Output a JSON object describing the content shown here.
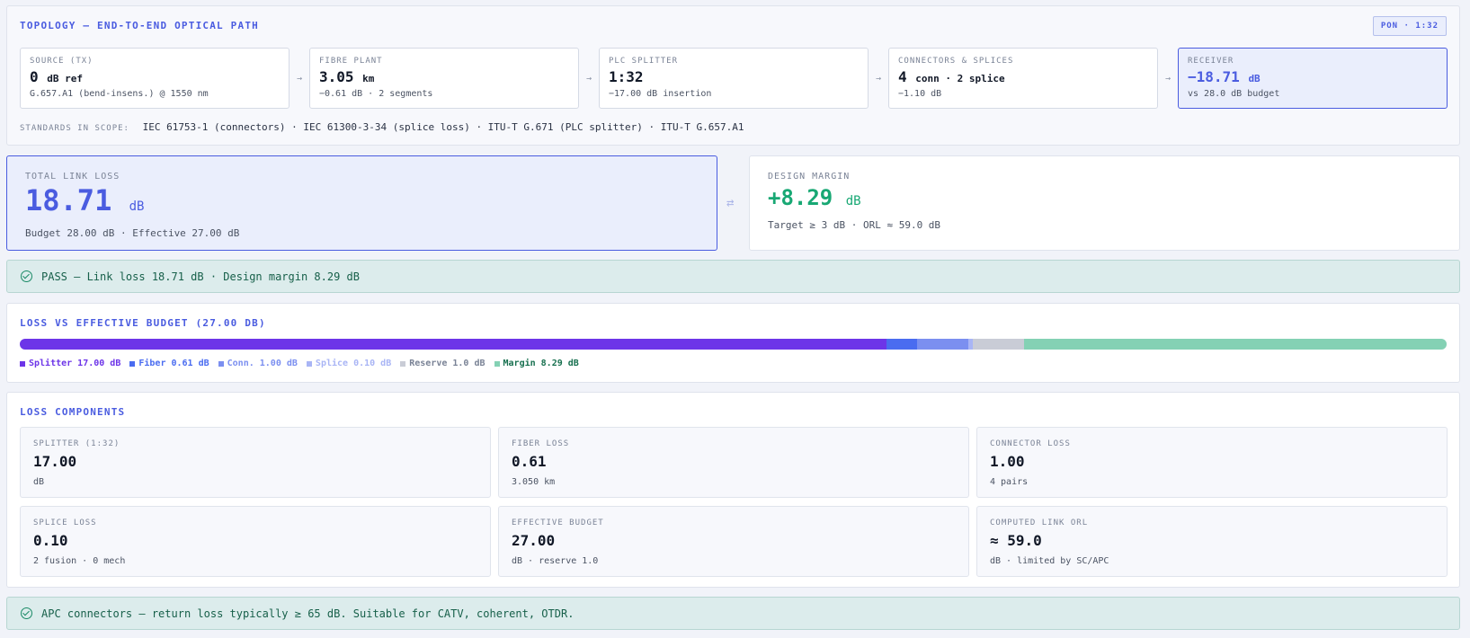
{
  "topology": {
    "title": "TOPOLOGY — END-TO-END OPTICAL PATH",
    "badge": "PON · 1:32",
    "arrow": "→",
    "cards": [
      {
        "label": "SOURCE (TX)",
        "value": "0",
        "unit": "dB ref",
        "sub": "G.657.A1 (bend-insens.) @ 1550 nm"
      },
      {
        "label": "FIBRE PLANT",
        "value": "3.05",
        "unit": "km",
        "sub": "−0.61 dB · 2 segments"
      },
      {
        "label": "PLC SPLITTER",
        "value": "1:32",
        "unit": "",
        "sub": "−17.00 dB insertion"
      },
      {
        "label": "CONNECTORS & SPLICES",
        "value": "4",
        "unit": "conn · 2 splice",
        "sub": "−1.10 dB"
      },
      {
        "label": "RECEIVER",
        "value": "−18.71",
        "unit": "dB",
        "sub": "vs 28.0 dB budget"
      }
    ],
    "standards_label": "STANDARDS IN SCOPE:",
    "standards": "IEC 61753-1 (connectors) · IEC 61300-3-34 (splice loss) · ITU-T G.671 (PLC splitter) · ITU-T G.657.A1"
  },
  "total_loss": {
    "label": "TOTAL LINK LOSS",
    "value": "18.71",
    "unit": "dB",
    "sub": "Budget 28.00 dB · Effective 27.00 dB"
  },
  "swap_icon": "⇄",
  "design_margin": {
    "label": "DESIGN MARGIN",
    "value": "+8.29",
    "unit": "dB",
    "sub": "Target ≥ 3 dB · ORL ≈ 59.0 dB"
  },
  "pass_banner": "PASS — Link loss 18.71 dB · Design margin 8.29 dB",
  "loss_budget": {
    "title": "LOSS VS EFFECTIVE BUDGET (27.00 DB)",
    "total": 27.38,
    "segments": [
      {
        "label": "Splitter 17.00 dB",
        "value": 17.0,
        "color": "#6d35e8",
        "text_color": "#6d35e8"
      },
      {
        "label": "Fiber 0.61 dB",
        "value": 0.61,
        "color": "#4a6cf0",
        "text_color": "#4a6cf0"
      },
      {
        "label": "Conn. 1.00 dB",
        "value": 1.0,
        "color": "#7b8ff0",
        "text_color": "#7b8ff0"
      },
      {
        "label": "Splice 0.10 dB",
        "value": 0.1,
        "color": "#a9b5f5",
        "text_color": "#a9b5f5"
      },
      {
        "label": "Reserve 1.0 dB",
        "value": 1.0,
        "color": "#c9ccd6",
        "text_color": "#7a8396"
      },
      {
        "label": "Margin 8.29 dB",
        "value": 8.29,
        "color": "#84d1b4",
        "text_color": "#17704f"
      }
    ]
  },
  "loss_components": {
    "title": "LOSS COMPONENTS",
    "cards": [
      {
        "label": "SPLITTER (1:32)",
        "value": "17.00",
        "sub": "dB"
      },
      {
        "label": "FIBER LOSS",
        "value": "0.61",
        "sub": "3.050 km"
      },
      {
        "label": "CONNECTOR LOSS",
        "value": "1.00",
        "sub": "4 pairs"
      },
      {
        "label": "SPLICE LOSS",
        "value": "0.10",
        "sub": "2 fusion · 0 mech"
      },
      {
        "label": "EFFECTIVE BUDGET",
        "value": "27.00",
        "sub": "dB · reserve 1.0"
      },
      {
        "label": "COMPUTED LINK ORL",
        "value": "≈ 59.0",
        "sub": "dB · limited by SC/APC"
      }
    ]
  },
  "apc_banner": "APC connectors — return loss typically ≥ 65 dB. Suitable for CATV, coherent, OTDR."
}
